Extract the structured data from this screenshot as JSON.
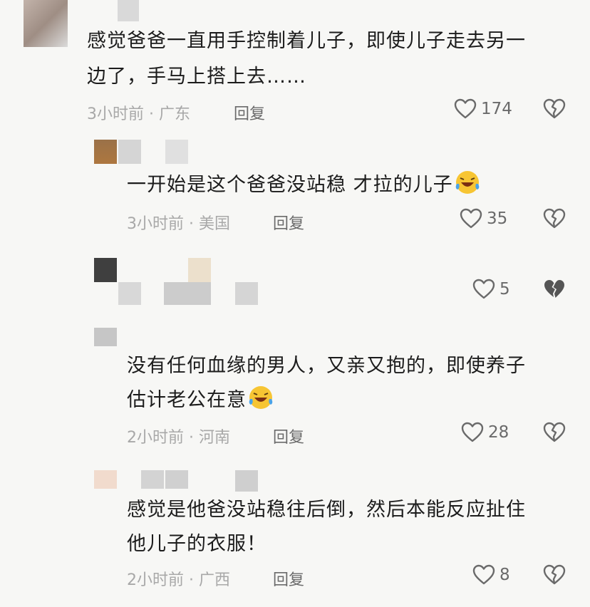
{
  "comments": [
    {
      "text_lines": [
        "感觉爸爸一直用手控制着儿子，即使儿子走去另一",
        "边了，手马上搭上去……"
      ],
      "time_location": "3小时前 · 广东",
      "reply_label": "回复",
      "likes": "174"
    },
    {
      "text_lines": [
        "一开始是这个爸爸没站稳 才拉的儿子"
      ],
      "time_location": "3小时前 · 美国",
      "reply_label": "回复",
      "likes": "35"
    },
    {
      "text_lines": [],
      "likes": "5"
    },
    {
      "text_lines": [
        "没有任何血缘的男人，又亲又抱的，即使养子",
        "估计老公在意"
      ],
      "time_location": "2小时前 · 河南",
      "reply_label": "回复",
      "likes": "28"
    },
    {
      "text_lines": [
        "感觉是他爸没站稳往后倒，然后本能反应扯住",
        "他儿子的衣服！"
      ],
      "time_location": "2小时前 · 广西",
      "reply_label": "回复",
      "likes": "8"
    }
  ],
  "icons": {
    "like": "heart-outline-icon",
    "dislike": "broken-heart-icon",
    "emoji": "laughing-tears-emoji"
  },
  "colors": {
    "background": "#f7f7f5",
    "meta_text": "#a8a8a8",
    "icon": "#6a6a6a"
  }
}
